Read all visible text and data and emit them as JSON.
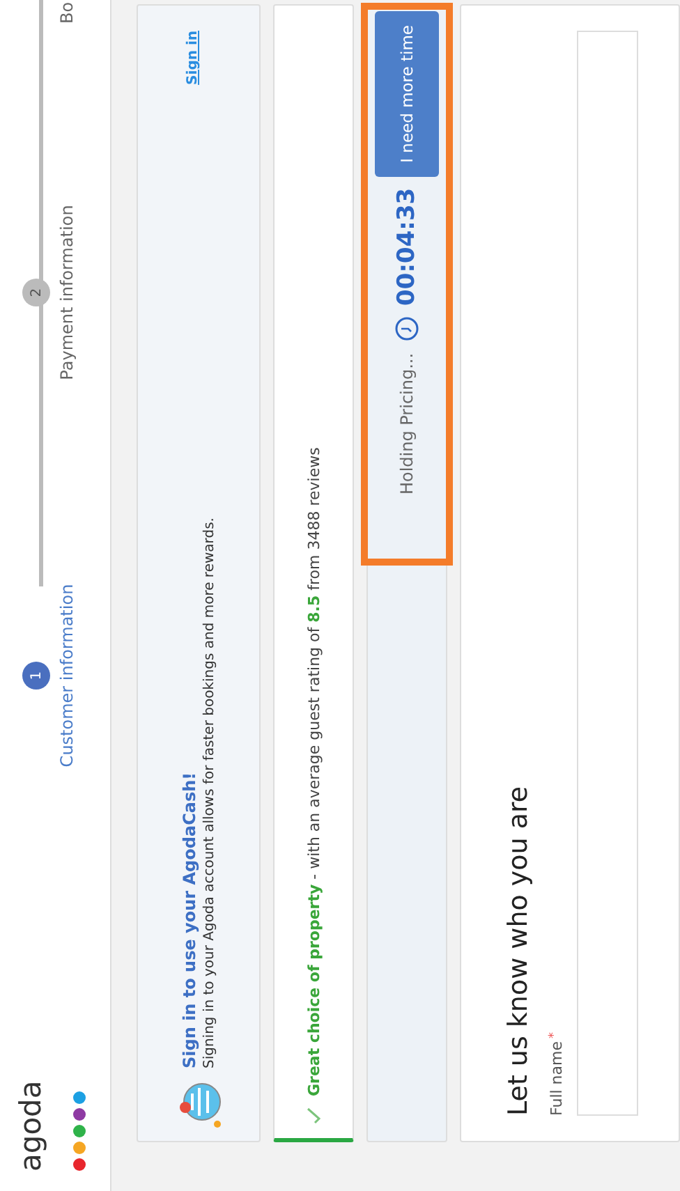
{
  "logo": {
    "text": "agoda"
  },
  "steps": [
    {
      "number": "1",
      "label": "Customer information",
      "selected": true
    },
    {
      "number": "2",
      "label": "Payment information",
      "selected": false
    },
    {
      "label": "Bo",
      "selected": false
    }
  ],
  "signin_banner": {
    "title": "Sign in to use your AgodaCash!",
    "text": "Signing in to your Agoda account allows for faster bookings and more rewards.",
    "link": "Sign in"
  },
  "rating_banner": {
    "text": "**Great choice of property** - with an average guest rating of **8.5** from 3488 reviews"
  },
  "price_hold": {
    "label": "Holding Pricing...",
    "timer": "00:04:33",
    "button": "I need more time",
    "highlighted": true
  },
  "form": {
    "title": "Let us know who you are",
    "fields": [
      {
        "label": "Full name",
        "required_mark": "*"
      }
    ]
  }
}
